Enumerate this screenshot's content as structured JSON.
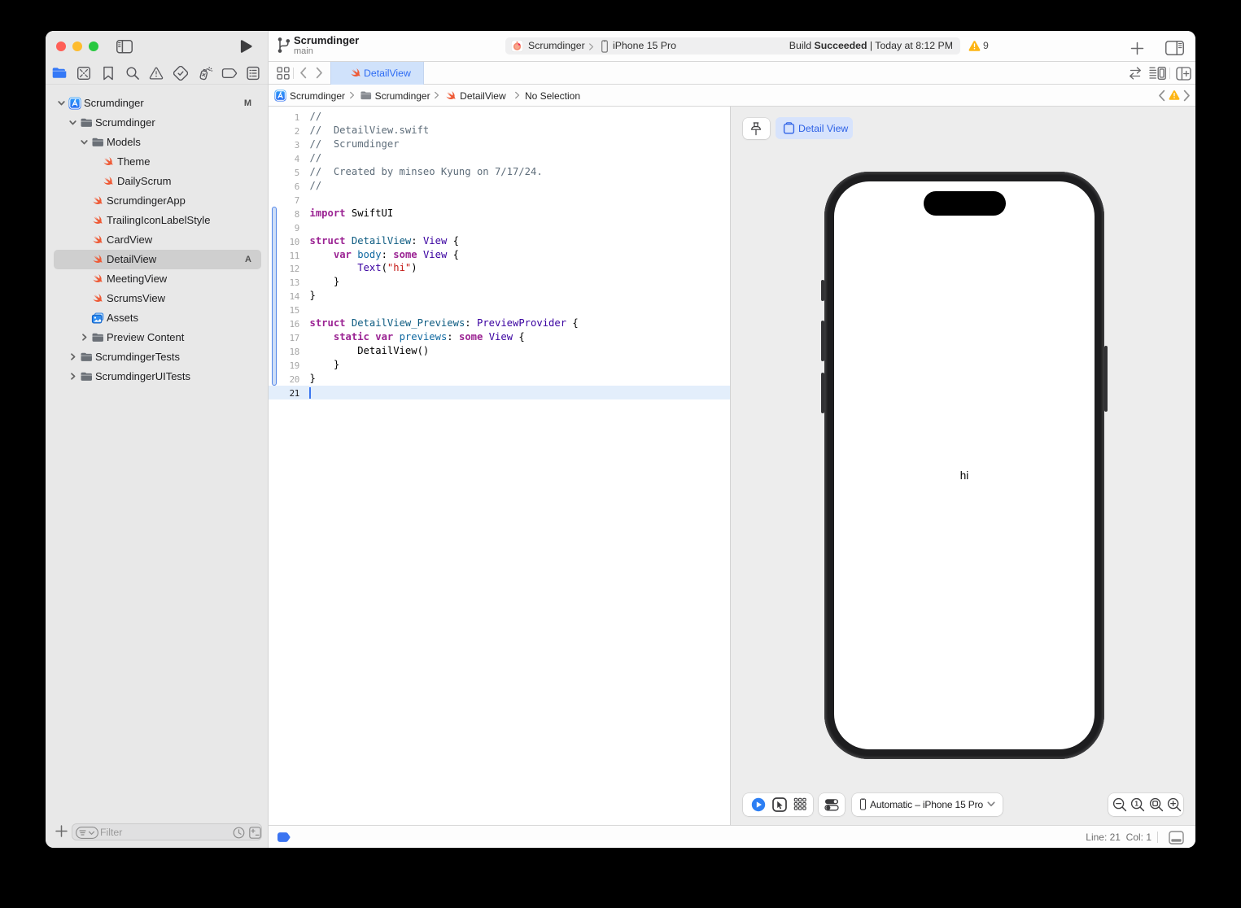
{
  "app": "Xcode",
  "toolbar": {
    "title": "Scrumdinger",
    "subtitle": "main",
    "scheme_project": "Scrumdinger",
    "scheme_device": "iPhone 15 Pro",
    "build_prefix": "Build ",
    "build_status": "Succeeded",
    "build_time": " | Today at 8:12 PM",
    "warning_count": "9"
  },
  "sidebar": {
    "navigator_tabs": [
      "project",
      "source-control",
      "bookmark",
      "search",
      "issue",
      "test",
      "debug",
      "breakpoint",
      "report"
    ],
    "selected_tab": "project",
    "tree": [
      {
        "label": "Scrumdinger",
        "icon": "project",
        "level": 0,
        "chevron": "open",
        "badge": "M"
      },
      {
        "label": "Scrumdinger",
        "icon": "folder",
        "level": 1,
        "chevron": "open"
      },
      {
        "label": "Models",
        "icon": "folder",
        "level": 2,
        "chevron": "open"
      },
      {
        "label": "Theme",
        "icon": "swift",
        "level": 3
      },
      {
        "label": "DailyScrum",
        "icon": "swift",
        "level": 3
      },
      {
        "label": "ScrumdingerApp",
        "icon": "swift",
        "level": 2
      },
      {
        "label": "TrailingIconLabelStyle",
        "icon": "swift",
        "level": 2
      },
      {
        "label": "CardView",
        "icon": "swift",
        "level": 2
      },
      {
        "label": "DetailView",
        "icon": "swift",
        "level": 2,
        "selected": true,
        "badge": "A"
      },
      {
        "label": "MeetingView",
        "icon": "swift",
        "level": 2
      },
      {
        "label": "ScrumsView",
        "icon": "swift",
        "level": 2
      },
      {
        "label": "Assets",
        "icon": "assets",
        "level": 2
      },
      {
        "label": "Preview Content",
        "icon": "folder",
        "level": 2,
        "chevron": "closed"
      },
      {
        "label": "ScrumdingerTests",
        "icon": "folder",
        "level": 1,
        "chevron": "closed"
      },
      {
        "label": "ScrumdingerUITests",
        "icon": "folder",
        "level": 1,
        "chevron": "closed"
      }
    ],
    "filter_placeholder": "Filter"
  },
  "tabbar": {
    "active_tab": "DetailView"
  },
  "jumpbar": {
    "segments": [
      {
        "icon": "project",
        "label": "Scrumdinger"
      },
      {
        "icon": "folder",
        "label": "Scrumdinger"
      },
      {
        "icon": "swift",
        "label": "DetailView"
      },
      {
        "icon": null,
        "label": "No Selection"
      }
    ]
  },
  "editor": {
    "lines": [
      {
        "n": 1,
        "segs": [
          [
            "cm",
            "//"
          ]
        ]
      },
      {
        "n": 2,
        "segs": [
          [
            "cm",
            "//  DetailView.swift"
          ]
        ]
      },
      {
        "n": 3,
        "segs": [
          [
            "cm",
            "//  Scrumdinger"
          ]
        ]
      },
      {
        "n": 4,
        "segs": [
          [
            "cm",
            "//"
          ]
        ]
      },
      {
        "n": 5,
        "segs": [
          [
            "cm",
            "//  Created by minseo Kyung on 7/17/24."
          ]
        ]
      },
      {
        "n": 6,
        "segs": [
          [
            "cm",
            "//"
          ]
        ]
      },
      {
        "n": 7,
        "segs": []
      },
      {
        "n": 8,
        "segs": [
          [
            "kw",
            "import"
          ],
          [
            "pl",
            " SwiftUI"
          ]
        ]
      },
      {
        "n": 9,
        "segs": []
      },
      {
        "n": 10,
        "segs": [
          [
            "kw",
            "struct"
          ],
          [
            "pl",
            " "
          ],
          [
            "ty",
            "DetailView"
          ],
          [
            "pl",
            ": "
          ],
          [
            "sdk",
            "View"
          ],
          [
            "pl",
            " {"
          ]
        ]
      },
      {
        "n": 11,
        "segs": [
          [
            "pl",
            "    "
          ],
          [
            "kw",
            "var"
          ],
          [
            "pl",
            " "
          ],
          [
            "mem",
            "body"
          ],
          [
            "pl",
            ": "
          ],
          [
            "kw",
            "some"
          ],
          [
            "pl",
            " "
          ],
          [
            "sdk",
            "View"
          ],
          [
            "pl",
            " {"
          ]
        ]
      },
      {
        "n": 12,
        "segs": [
          [
            "pl",
            "        "
          ],
          [
            "sdk",
            "Text"
          ],
          [
            "pl",
            "("
          ],
          [
            "str",
            "\"hi\""
          ],
          [
            "pl",
            ")"
          ]
        ]
      },
      {
        "n": 13,
        "segs": [
          [
            "pl",
            "    }"
          ]
        ]
      },
      {
        "n": 14,
        "segs": [
          [
            "pl",
            "}"
          ]
        ]
      },
      {
        "n": 15,
        "segs": []
      },
      {
        "n": 16,
        "segs": [
          [
            "kw",
            "struct"
          ],
          [
            "pl",
            " "
          ],
          [
            "ty",
            "DetailView_Previews"
          ],
          [
            "pl",
            ": "
          ],
          [
            "sdk",
            "PreviewProvider"
          ],
          [
            "pl",
            " {"
          ]
        ]
      },
      {
        "n": 17,
        "segs": [
          [
            "pl",
            "    "
          ],
          [
            "kw",
            "static"
          ],
          [
            "pl",
            " "
          ],
          [
            "kw",
            "var"
          ],
          [
            "pl",
            " "
          ],
          [
            "mem",
            "previews"
          ],
          [
            "pl",
            ": "
          ],
          [
            "kw",
            "some"
          ],
          [
            "pl",
            " "
          ],
          [
            "sdk",
            "View"
          ],
          [
            "pl",
            " {"
          ]
        ]
      },
      {
        "n": 18,
        "segs": [
          [
            "pl",
            "        DetailView()"
          ]
        ]
      },
      {
        "n": 19,
        "segs": [
          [
            "pl",
            "    }"
          ]
        ]
      },
      {
        "n": 20,
        "segs": [
          [
            "pl",
            "}"
          ]
        ]
      },
      {
        "n": 21,
        "segs": []
      }
    ],
    "current_line": 21,
    "changed_lines": [
      8,
      20
    ]
  },
  "canvas": {
    "preview_button": "Detail View",
    "phone_text": "hi",
    "device_label": "Automatic – iPhone 15 Pro"
  },
  "statusbar": {
    "line_col": "Line: 21  Col: 1"
  },
  "colors": {
    "accent_blue": "#2e62e6",
    "swift_orange": "#e8542e",
    "warning_yellow": "#f6b40b"
  }
}
